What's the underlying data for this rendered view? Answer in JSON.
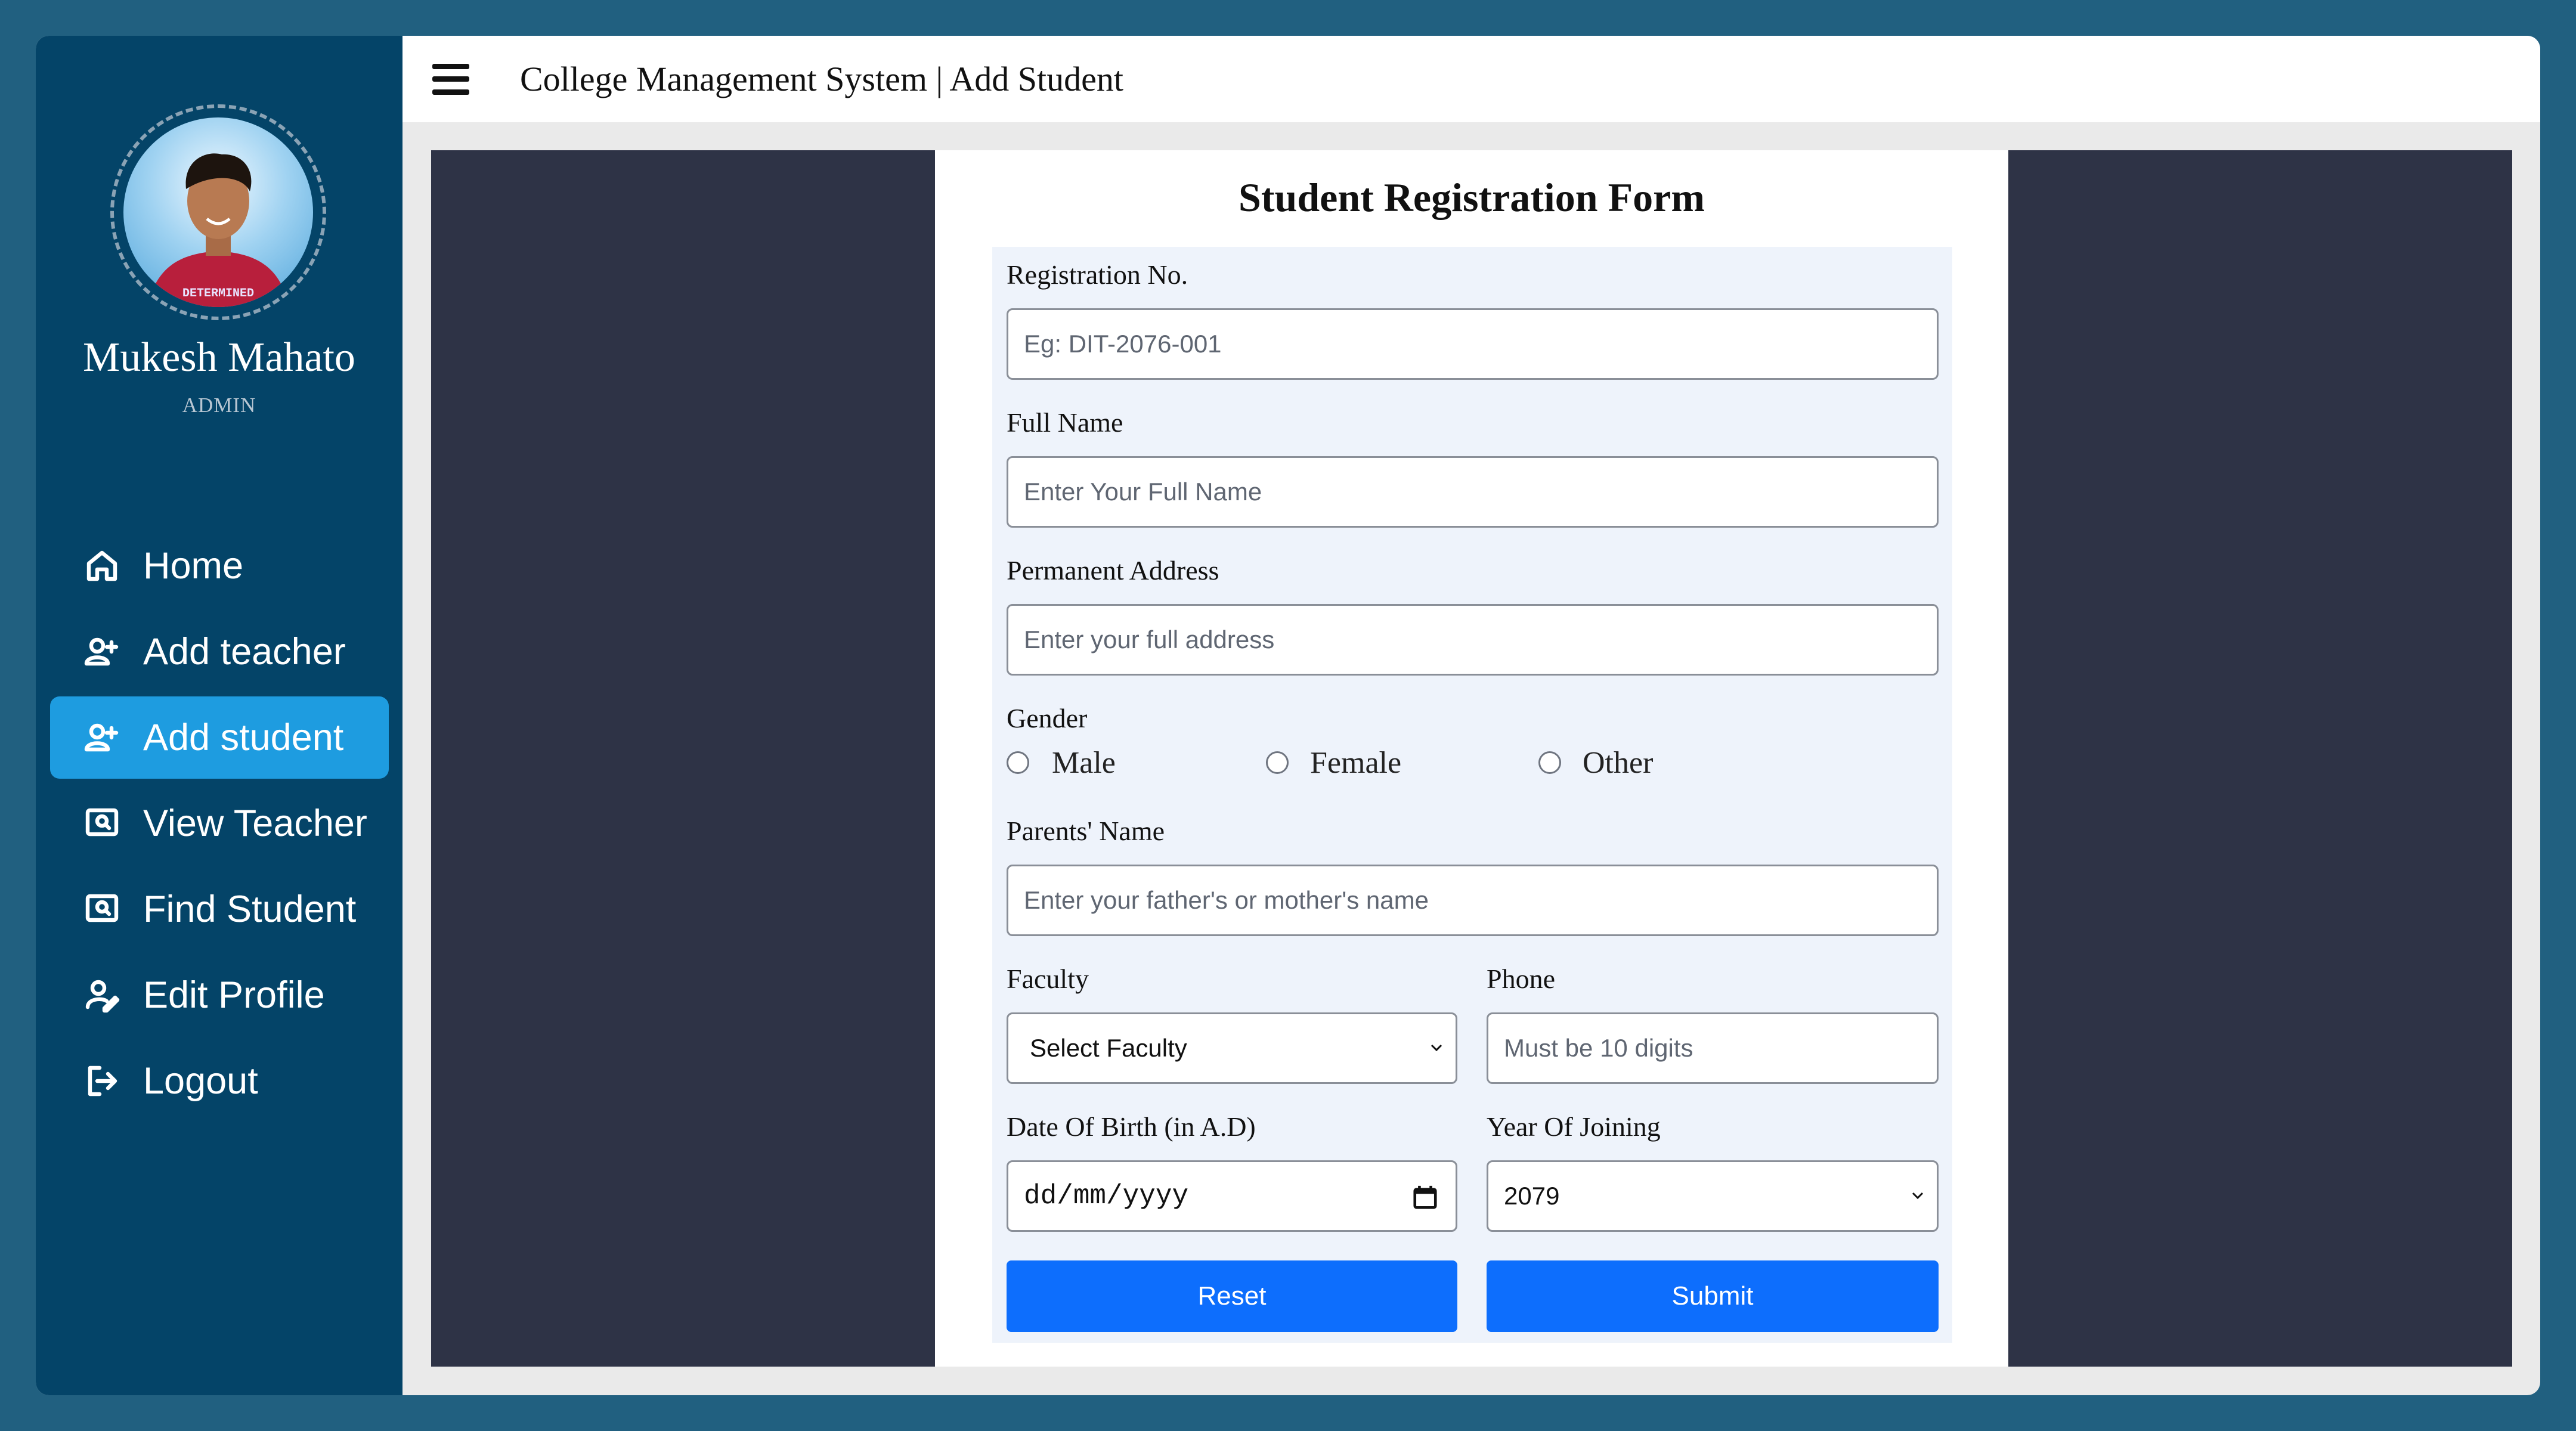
{
  "header": {
    "title": "College Management System | Add Student"
  },
  "user": {
    "name": "Mukesh Mahato",
    "role": "ADMIN",
    "shirt_text": "DETERMINED"
  },
  "sidebar": {
    "items": [
      {
        "label": "Home",
        "icon": "home-icon"
      },
      {
        "label": "Add teacher",
        "icon": "user-plus-icon"
      },
      {
        "label": "Add student",
        "icon": "user-plus-icon",
        "active": true
      },
      {
        "label": "View Teacher",
        "icon": "view-icon"
      },
      {
        "label": "Find Student",
        "icon": "view-icon"
      },
      {
        "label": "Edit Profile",
        "icon": "edit-user-icon"
      },
      {
        "label": "Logout",
        "icon": "logout-icon"
      }
    ]
  },
  "form": {
    "title": "Student Registration Form",
    "registration": {
      "label": "Registration No.",
      "placeholder": "Eg: DIT-2076-001"
    },
    "full_name": {
      "label": "Full Name",
      "placeholder": "Enter Your Full Name"
    },
    "address": {
      "label": "Permanent Address",
      "placeholder": "Enter your full address"
    },
    "gender": {
      "label": "Gender",
      "options": [
        "Male",
        "Female",
        "Other"
      ]
    },
    "parents": {
      "label": "Parents' Name",
      "placeholder": "Enter your father's or mother's name"
    },
    "faculty": {
      "label": "Faculty",
      "value": "Select Faculty"
    },
    "phone": {
      "label": "Phone",
      "placeholder": "Must be 10 digits"
    },
    "dob": {
      "label": "Date Of Birth (in A.D)",
      "value": "dd/mm/yyyy"
    },
    "year_joining": {
      "label": "Year Of Joining",
      "value": "2079"
    },
    "reset_label": "Reset",
    "submit_label": "Submit"
  },
  "colors": {
    "page_bg": "#216080",
    "sidebar_bg": "#044468",
    "active_item": "#1e9ce0",
    "content_bg": "#2e3346",
    "form_bg": "#eef3fb",
    "button": "#0d6efd"
  }
}
